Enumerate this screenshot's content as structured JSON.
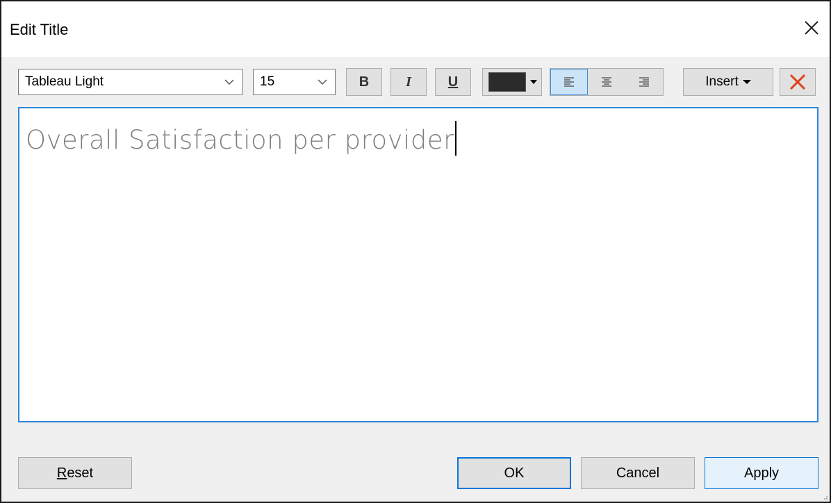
{
  "window": {
    "title": "Edit Title",
    "close_icon": "close-icon"
  },
  "toolbar": {
    "font_family_value": "Tableau Light",
    "font_size_value": "15",
    "bold_label": "B",
    "italic_label": "I",
    "underline_label": "U",
    "text_color": "#2b2b2b",
    "align_options": [
      "align-left-icon",
      "align-center-icon",
      "align-right-icon"
    ],
    "align_selected": "align-left-icon",
    "insert_label": "Insert",
    "clear_icon": "clear-formatting-x-icon",
    "clear_icon_color": "#e0401c"
  },
  "editor": {
    "text": "Overall Satisfaction per provider",
    "text_color": "#7f7f7f"
  },
  "footer": {
    "reset_label_mnemonic": "R",
    "reset_label_rest": "eset",
    "ok_label": "OK",
    "cancel_label": "Cancel",
    "apply_label": "Apply"
  },
  "colors": {
    "focus_blue": "#2f86d6",
    "dialog_bg": "#f0f0f0",
    "button_bg": "#e1e1e1"
  }
}
